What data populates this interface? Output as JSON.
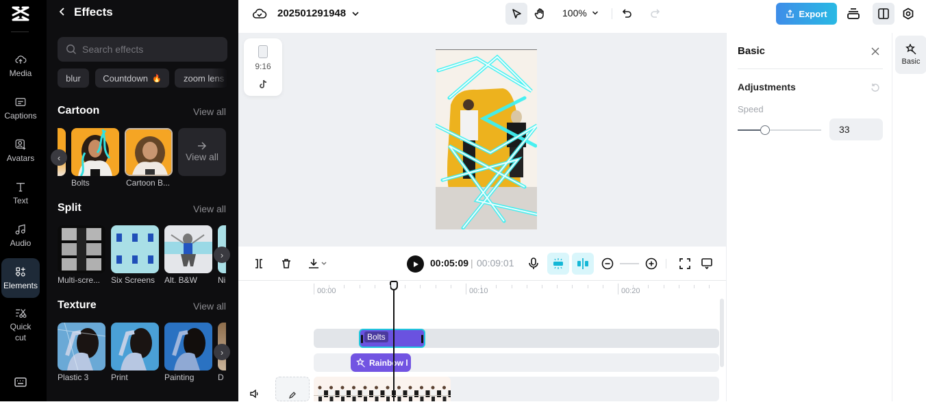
{
  "rail": {
    "items": [
      {
        "label": "Media",
        "icon": "cloud-upload-icon"
      },
      {
        "label": "Captions",
        "icon": "captions-icon"
      },
      {
        "label": "Avatars",
        "icon": "avatar-icon"
      },
      {
        "label": "Text",
        "icon": "text-icon"
      },
      {
        "label": "Audio",
        "icon": "music-note-icon"
      },
      {
        "label": "Elements",
        "icon": "elements-icon",
        "active": true
      },
      {
        "label": "Quick cut",
        "icon": "quick-cut-icon"
      }
    ],
    "bottom_icon": "keyboard-icon"
  },
  "effects": {
    "title": "Effects",
    "search_placeholder": "Search effects",
    "chips": [
      "blur",
      "Countdown",
      "zoom lens"
    ],
    "chip_hot_icon": "🔥",
    "sections": [
      {
        "title": "Cartoon",
        "view_all": "View all",
        "items": [
          "Bolts",
          "Cartoon B..."
        ],
        "more_label": "View all"
      },
      {
        "title": "Split",
        "view_all": "View all",
        "items": [
          "Multi-scre...",
          "Six Screens",
          "Alt. B&W",
          "Ni"
        ]
      },
      {
        "title": "Texture",
        "view_all": "View all",
        "items": [
          "Plastic 3",
          "Print",
          "Painting",
          "D"
        ]
      }
    ]
  },
  "topbar": {
    "project_name": "202501291948",
    "zoom": "100%",
    "export_label": "Export"
  },
  "canvas": {
    "aspect_ratio": "9:16"
  },
  "timeline": {
    "current_time": "00:05:09",
    "separator": "|",
    "total_time": "00:09:01",
    "ruler": [
      "00:00",
      "00:10",
      "00:20"
    ],
    "clips": {
      "effect": "Bolts",
      "effect2": "Rainbow l"
    }
  },
  "properties": {
    "title": "Basic",
    "section": "Adjustments",
    "speed_label": "Speed",
    "speed_value": "33",
    "speed_fraction": 0.33
  },
  "right_tabs": [
    {
      "label": "Basic"
    }
  ],
  "colors": {
    "accent": "#29b9e4",
    "clip": "#6a52e0",
    "clip_border": "#1fc7de"
  }
}
